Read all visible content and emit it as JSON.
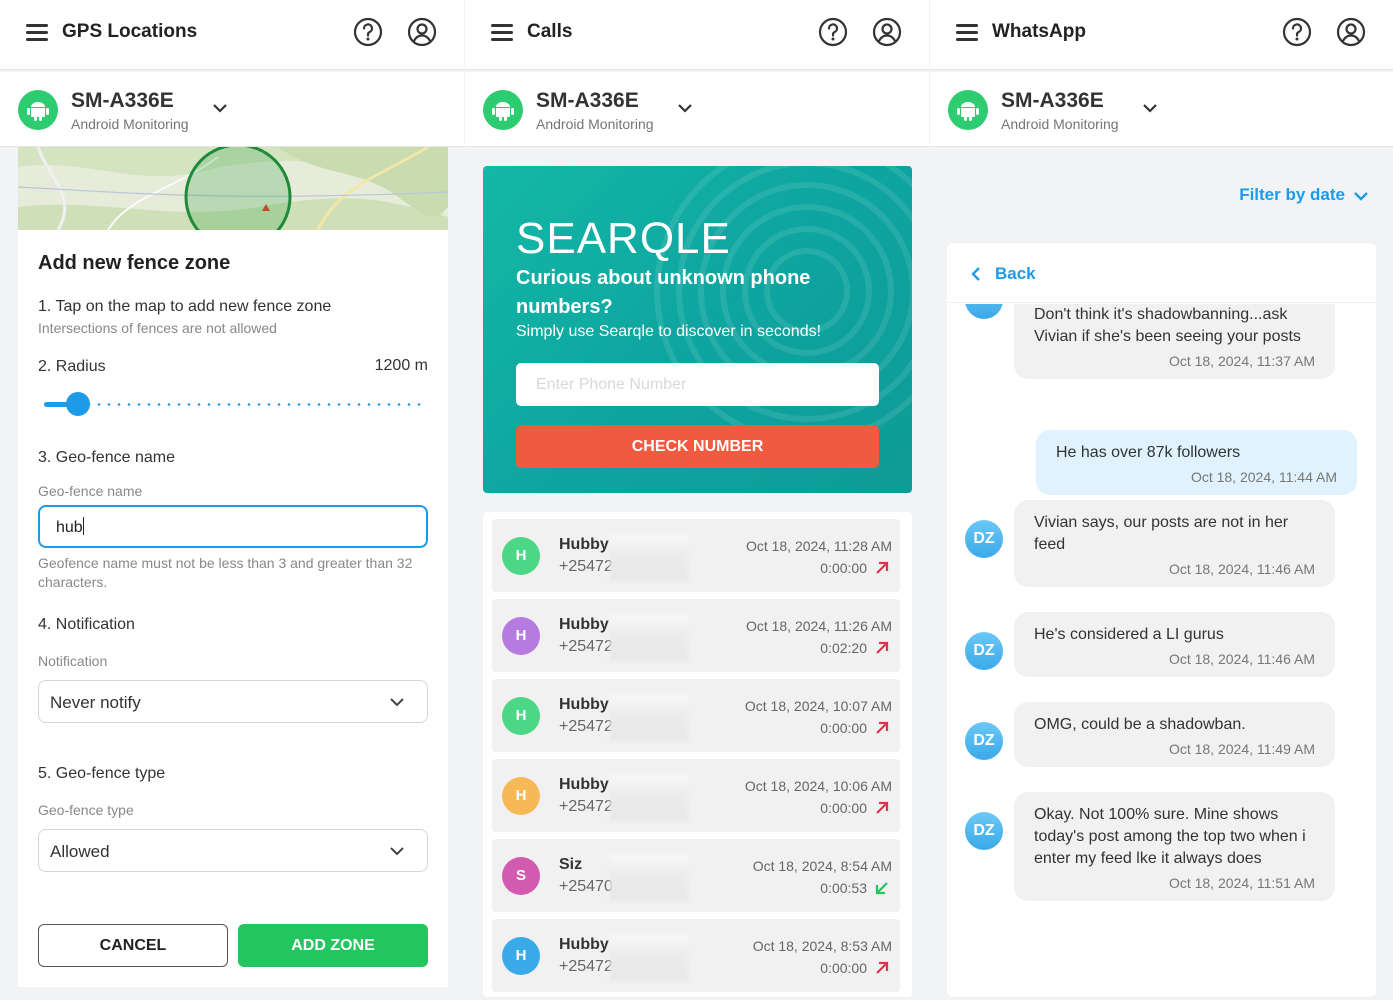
{
  "device": {
    "name": "SM-A336E",
    "subtitle": "Android Monitoring"
  },
  "gps": {
    "title": "GPS Locations",
    "heading": "Add new fence zone",
    "step1": "1. Tap on the map to add new fence zone",
    "step1_hint": "Intersections of fences are not allowed",
    "step2": "2. Radius",
    "radius_value": "1200 m",
    "radius_fraction": 0.09,
    "step3": "3. Geo-fence name",
    "name_label": "Geo-fence name",
    "name_value": "hub",
    "name_hint": "Geofence name must not be less than 3 and greater than 32 characters.",
    "step4": "4. Notification",
    "notification_label": "Notification",
    "notification_value": "Never notify",
    "step5": "5. Geo-fence type",
    "type_label": "Geo-fence type",
    "type_value": "Allowed",
    "cancel_label": "CANCEL",
    "add_label": "ADD ZONE"
  },
  "calls": {
    "title": "Calls",
    "banner": {
      "logo": "SEARQLE",
      "title": "Curious about unknown phone numbers?",
      "subtitle": "Simply use Searqle to discover in seconds!",
      "placeholder": "Enter Phone Number",
      "button": "CHECK NUMBER"
    },
    "rows": [
      {
        "initial": "H",
        "color": "#4cd787",
        "name": "Hubby",
        "number": "+25472",
        "date": "Oct 18, 2024, 11:28 AM",
        "duration": "0:00:00",
        "direction": "outgoing"
      },
      {
        "initial": "H",
        "color": "#b67be0",
        "name": "Hubby",
        "number": "+25472",
        "date": "Oct 18, 2024, 11:26 AM",
        "duration": "0:02:20",
        "direction": "outgoing"
      },
      {
        "initial": "H",
        "color": "#4cd787",
        "name": "Hubby",
        "number": "+25472",
        "date": "Oct 18, 2024, 10:07 AM",
        "duration": "0:00:00",
        "direction": "outgoing"
      },
      {
        "initial": "H",
        "color": "#f7b955",
        "name": "Hubby",
        "number": "+25472",
        "date": "Oct 18, 2024, 10:06 AM",
        "duration": "0:00:00",
        "direction": "outgoing"
      },
      {
        "initial": "S",
        "color": "#d25bb0",
        "name": "Siz",
        "number": "+25470",
        "date": "Oct 18, 2024, 8:54 AM",
        "duration": "0:00:53",
        "direction": "incoming"
      },
      {
        "initial": "H",
        "color": "#3aa9e8",
        "name": "Hubby",
        "number": "+25472",
        "date": "Oct 18, 2024, 8:53 AM",
        "duration": "0:00:00",
        "direction": "outgoing"
      }
    ]
  },
  "whatsapp": {
    "title": "WhatsApp",
    "filter_label": "Filter by date",
    "back_label": "Back",
    "messages": [
      {
        "from": "DZ",
        "direction": "in",
        "text": "Don't think it's shadowbanning...ask Vivian if she's been seeing your posts",
        "time": "Oct 18, 2024, 11:37 AM"
      },
      {
        "from": "",
        "direction": "out",
        "text": "He has over 87k followers",
        "time": "Oct 18, 2024, 11:44 AM"
      },
      {
        "from": "DZ",
        "direction": "in",
        "text": "Vivian says, our posts are not in her feed",
        "time": "Oct 18, 2024, 11:46 AM"
      },
      {
        "from": "DZ",
        "direction": "in",
        "text": "He's considered a LI gurus",
        "time": "Oct 18, 2024, 11:46 AM"
      },
      {
        "from": "DZ",
        "direction": "in",
        "text": "OMG, could be a shadowban.",
        "time": "Oct 18, 2024, 11:49 AM"
      },
      {
        "from": "DZ",
        "direction": "in",
        "text": "Okay. Not 100% sure. Mine shows today's post among the top two when i enter my feed lke it always does",
        "time": "Oct 18, 2024, 11:51 AM"
      }
    ]
  },
  "colors": {
    "accent": "#1e9be8",
    "green": "#22c55e",
    "orange": "#f05a3e",
    "teal": "#14b8a6"
  }
}
